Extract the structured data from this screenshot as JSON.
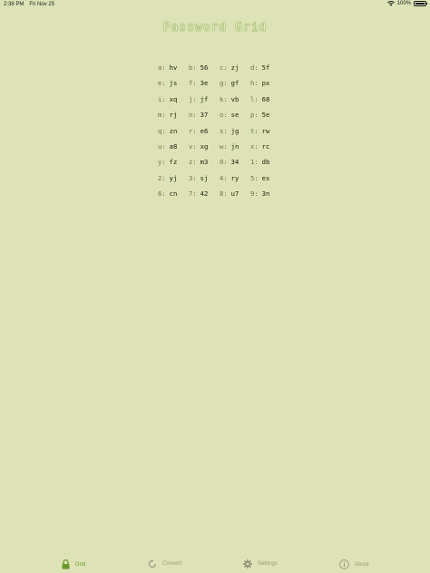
{
  "status": {
    "time": "2:38 PM",
    "date": "Fri Nov 25",
    "battery": "100%",
    "battery_level": 1.0
  },
  "title": "Password Grid",
  "grid": [
    {
      "key": "a:",
      "value": "hv"
    },
    {
      "key": "b:",
      "value": "56"
    },
    {
      "key": "c:",
      "value": "zj"
    },
    {
      "key": "d:",
      "value": "5f"
    },
    {
      "key": "e:",
      "value": "js"
    },
    {
      "key": "f:",
      "value": "3e"
    },
    {
      "key": "g:",
      "value": "gf"
    },
    {
      "key": "h:",
      "value": "px"
    },
    {
      "key": "i:",
      "value": "xq"
    },
    {
      "key": "j:",
      "value": "jf"
    },
    {
      "key": "k:",
      "value": "vb"
    },
    {
      "key": "l:",
      "value": "68"
    },
    {
      "key": "m:",
      "value": "rj"
    },
    {
      "key": "n:",
      "value": "37"
    },
    {
      "key": "o:",
      "value": "se"
    },
    {
      "key": "p:",
      "value": "5e"
    },
    {
      "key": "q:",
      "value": "zn"
    },
    {
      "key": "r:",
      "value": "e6"
    },
    {
      "key": "s:",
      "value": "jg"
    },
    {
      "key": "t:",
      "value": "rw"
    },
    {
      "key": "u:",
      "value": "a8"
    },
    {
      "key": "v:",
      "value": "xg"
    },
    {
      "key": "w:",
      "value": "jn"
    },
    {
      "key": "x:",
      "value": "rc"
    },
    {
      "key": "y:",
      "value": "fz"
    },
    {
      "key": "z:",
      "value": "m3"
    },
    {
      "key": "0:",
      "value": "34"
    },
    {
      "key": "1:",
      "value": "db"
    },
    {
      "key": "2:",
      "value": "yj"
    },
    {
      "key": "3:",
      "value": "sj"
    },
    {
      "key": "4:",
      "value": "ry"
    },
    {
      "key": "5:",
      "value": "es"
    },
    {
      "key": "6:",
      "value": "cn"
    },
    {
      "key": "7:",
      "value": "42"
    },
    {
      "key": "8:",
      "value": "u7"
    },
    {
      "key": "9:",
      "value": "3n"
    }
  ],
  "tabs": [
    {
      "label": "Grid",
      "icon": "lock-icon",
      "active": true
    },
    {
      "label": "Convert",
      "icon": "refresh-icon",
      "active": false
    },
    {
      "label": "Settings",
      "icon": "gear-icon",
      "active": false
    },
    {
      "label": "About",
      "icon": "info-icon",
      "active": false
    }
  ],
  "colors": {
    "background": "#dde3b6",
    "accent": "#6a9a2c",
    "inactive": "#9a9a82"
  }
}
